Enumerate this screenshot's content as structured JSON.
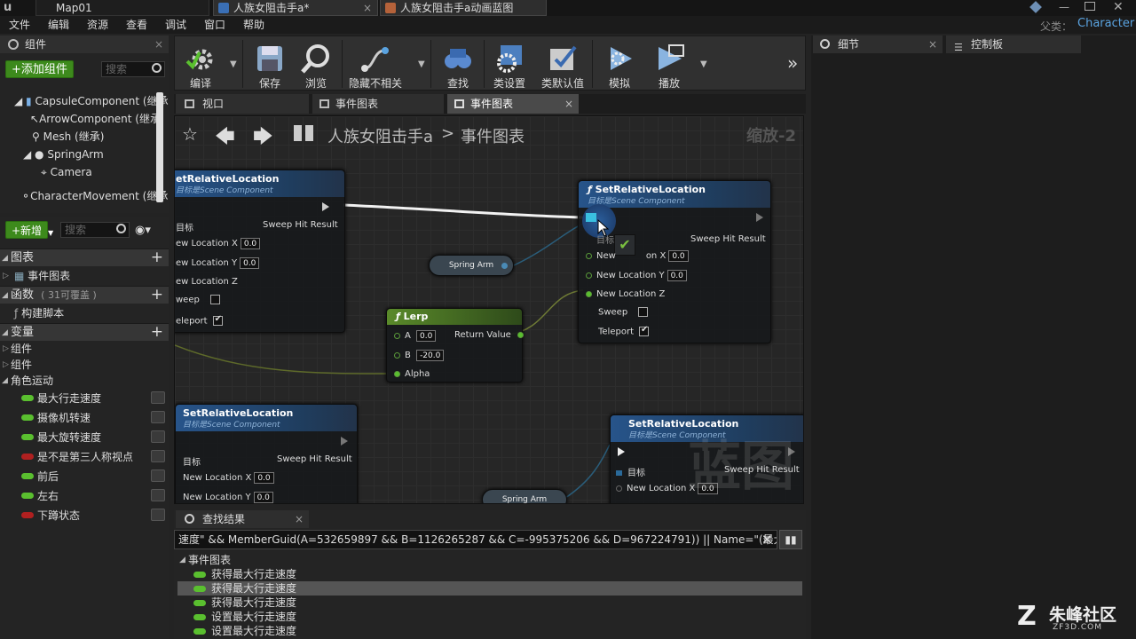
{
  "titlebar": {
    "tabs": [
      {
        "label": "Map01"
      },
      {
        "label": "人族女阻击手a*"
      },
      {
        "label": "人族女阻击手a动画蓝图"
      }
    ]
  },
  "menu": {
    "items": [
      "文件",
      "编辑",
      "资源",
      "查看",
      "调试",
      "窗口",
      "帮助"
    ],
    "parent_label": "父类：",
    "parent_value": "Character"
  },
  "components_panel": {
    "title": "组件",
    "add_button": "+添加组件",
    "search_placeholder": "搜索",
    "tree": [
      "CapsuleComponent (继承",
      "ArrowComponent (继承",
      "Mesh (继承)",
      "SpringArm",
      "Camera",
      "CharacterMovement (继承"
    ]
  },
  "mybp_panel": {
    "new_button": "+新增",
    "search_placeholder": "搜索",
    "graphs_header": "图表",
    "graph_item": "事件图表",
    "functions_header": "函数",
    "functions_count": "( 31可覆盖 )",
    "function_item": "构建脚本",
    "variables_header": "变量",
    "var_groups": [
      "组件",
      "组件",
      "角色运动"
    ],
    "variables": [
      {
        "name": "最大行走速度",
        "color": "#5abf2f"
      },
      {
        "name": "摄像机转速",
        "color": "#5abf2f"
      },
      {
        "name": "最大旋转速度",
        "color": "#5abf2f"
      },
      {
        "name": "是不是第三人称视点",
        "color": "#b02020"
      },
      {
        "name": "前后",
        "color": "#5abf2f"
      },
      {
        "name": "左右",
        "color": "#5abf2f"
      },
      {
        "name": "下蹲状态",
        "color": "#b02020"
      }
    ]
  },
  "toolbar": {
    "compile": "编译",
    "save": "保存",
    "browse": "浏览",
    "hide_unrelated": "隐藏不相关",
    "find": "查找",
    "class_settings": "类设置",
    "class_defaults": "类默认值",
    "simulate": "模拟",
    "play": "播放"
  },
  "editor_tabs": [
    "视口",
    "事件图表",
    "事件图表"
  ],
  "graph": {
    "breadcrumb_root": "人族女阻击手a",
    "breadcrumb_sep": ">",
    "breadcrumb_leaf": "事件图表",
    "zoom": "缩放-2",
    "watermark": "蓝图",
    "node_title": "SetRelativeLocation",
    "node_title_cut": "etRelativeLocation",
    "node_sub": "目标是Scene Component",
    "node_sub_cut": "目标是Scene Component",
    "pin_target": "目标",
    "pin_target_cut": "目标",
    "pin_sweep_hit": "Sweep Hit Result",
    "pin_nlx": "New Location X",
    "pin_nlx_cut": "ew Location X",
    "pin_nlx_hover": "New",
    "pin_nlx_hover_end": "on X",
    "pin_nly": "New Location Y",
    "pin_nly_cut": "ew Location Y",
    "pin_nlz": "New Location Z",
    "pin_nlz_cut": "ew Location Z",
    "pin_sweep": "Sweep",
    "pin_sweep_cut": "weep",
    "pin_teleport": "Teleport",
    "pin_teleport_cut": "eleport",
    "zero": "0.0",
    "spring_arm": "Spring Arm",
    "lerp_title": "Lerp",
    "lerp_a": "A",
    "lerp_a_val": "0.0",
    "lerp_b": "B",
    "lerp_b_val": "-20.0",
    "lerp_alpha": "Alpha",
    "lerp_return": "Return Value"
  },
  "right_tabs": {
    "details": "细节",
    "palette": "控制板"
  },
  "find_results": {
    "tab": "查找结果",
    "query": "速度\" && MemberGuid(A=532659897 && B=1126265287 && C=-995375206 && D=967224791)) || Name=\"(最大行走速度)\")",
    "category": "事件图表",
    "results": [
      "获得最大行走速度",
      "获得最大行走速度",
      "获得最大行走速度",
      "设置最大行走速度",
      "设置最大行走速度"
    ],
    "selected_index": 1
  },
  "watermark_brand": {
    "name": "朱峰社区",
    "url": "ZF3D.COM"
  }
}
